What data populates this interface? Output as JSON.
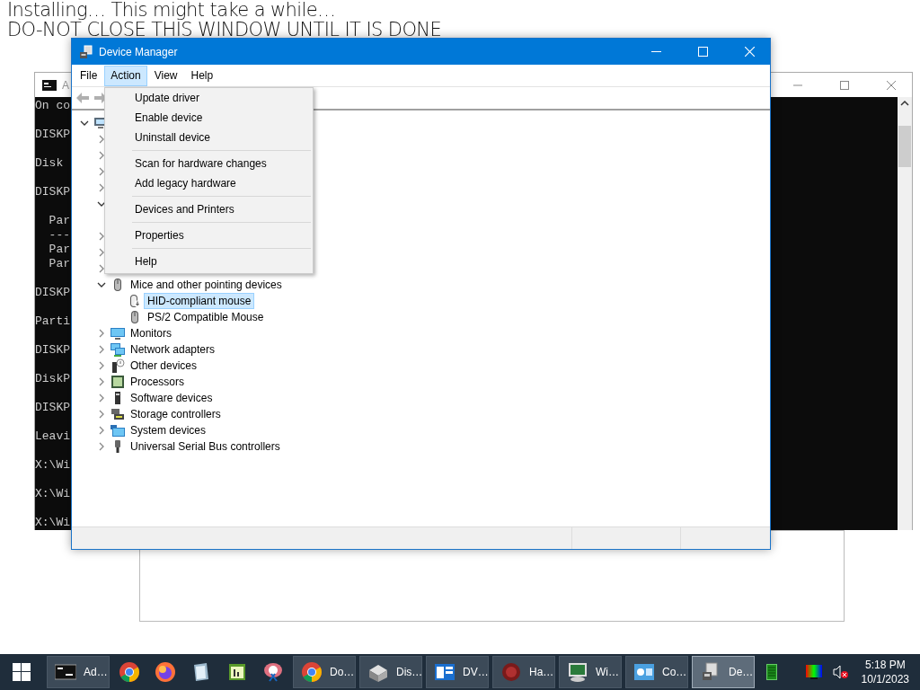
{
  "banner": {
    "lines": [
      "Installing… This might take a while…",
      "DO-NOT CLOSE THIS WINDOW UNTIL IT IS DONE"
    ]
  },
  "console": {
    "title": "A",
    "paragraphs": [
      [
        "On co"
      ],
      [
        "DISKP"
      ],
      [
        "Disk"
      ],
      [
        "DISKP"
      ],
      [
        "  Par",
        "  ---",
        "  Par",
        "  Par"
      ],
      [
        "DISKP"
      ],
      [
        "Parti"
      ],
      [
        "DISKP"
      ],
      [
        "DiskP"
      ],
      [
        "DISKP"
      ],
      [
        "Leavi"
      ],
      [
        "X:\\Wi"
      ],
      [
        "X:\\Wi"
      ],
      [
        "X:\\Wi"
      ]
    ]
  },
  "window": {
    "title": "Device Manager"
  },
  "menu_bar": [
    {
      "label": "File",
      "selected": false
    },
    {
      "label": "Action",
      "selected": true
    },
    {
      "label": "View",
      "selected": false
    },
    {
      "label": "Help",
      "selected": false
    }
  ],
  "action_menu": {
    "groups": [
      [
        "Update driver",
        "Enable device",
        "Uninstall device"
      ],
      [
        "Scan for hardware changes",
        "Add legacy hardware"
      ],
      [
        "Devices and Printers"
      ],
      [
        "Properties"
      ],
      [
        "Help"
      ]
    ]
  },
  "tree": [
    {
      "kind": "computer",
      "expanded": true,
      "children": [
        {
          "expanded": false
        },
        {
          "expanded": false
        },
        {
          "expanded": false
        },
        {
          "expanded": false
        },
        {
          "expanded": true
        },
        {
          "expanded": false
        },
        {
          "expanded": false
        },
        {
          "expanded": false
        },
        {
          "kind": "mouse",
          "label": "Mice and other pointing devices",
          "expanded": true,
          "selected": false,
          "children": [
            {
              "kind": "hid",
              "label": "HID-compliant mouse",
              "selected": true
            },
            {
              "kind": "mouse",
              "label": "PS/2 Compatible Mouse",
              "selected": false
            }
          ]
        },
        {
          "kind": "monitor",
          "label": "Monitors",
          "expanded": false,
          "selected": false
        },
        {
          "kind": "network",
          "label": "Network adapters",
          "expanded": false,
          "selected": false
        },
        {
          "kind": "other",
          "label": "Other devices",
          "expanded": false,
          "selected": false
        },
        {
          "kind": "processor",
          "label": "Processors",
          "expanded": false,
          "selected": false
        },
        {
          "kind": "software",
          "label": "Software devices",
          "expanded": false,
          "selected": false
        },
        {
          "kind": "storage",
          "label": "Storage controllers",
          "expanded": false,
          "selected": false
        },
        {
          "kind": "system",
          "label": "System devices",
          "expanded": false,
          "selected": false
        },
        {
          "kind": "usb",
          "label": "Universal Serial Bus controllers",
          "expanded": false,
          "selected": false
        }
      ]
    }
  ],
  "taskbar": {
    "items": [
      {
        "kind": "window",
        "label": "Ad…",
        "selected": false
      },
      {
        "kind": "pinned"
      },
      {
        "kind": "pinned"
      },
      {
        "kind": "pinned"
      },
      {
        "kind": "pinned"
      },
      {
        "kind": "pinned"
      },
      {
        "kind": "window",
        "label": "Do…",
        "selected": false
      },
      {
        "kind": "window",
        "label": "Dis…",
        "selected": false
      },
      {
        "kind": "window",
        "label": "DV…",
        "selected": false
      },
      {
        "kind": "window",
        "label": "Ha…",
        "selected": false
      },
      {
        "kind": "window",
        "label": "Wi…",
        "selected": false
      },
      {
        "kind": "window",
        "label": "Co…",
        "selected": false
      },
      {
        "kind": "window",
        "label": "De…",
        "selected": true
      }
    ],
    "clock": {
      "time": "5:18 PM",
      "date": "10/1/2023"
    }
  }
}
